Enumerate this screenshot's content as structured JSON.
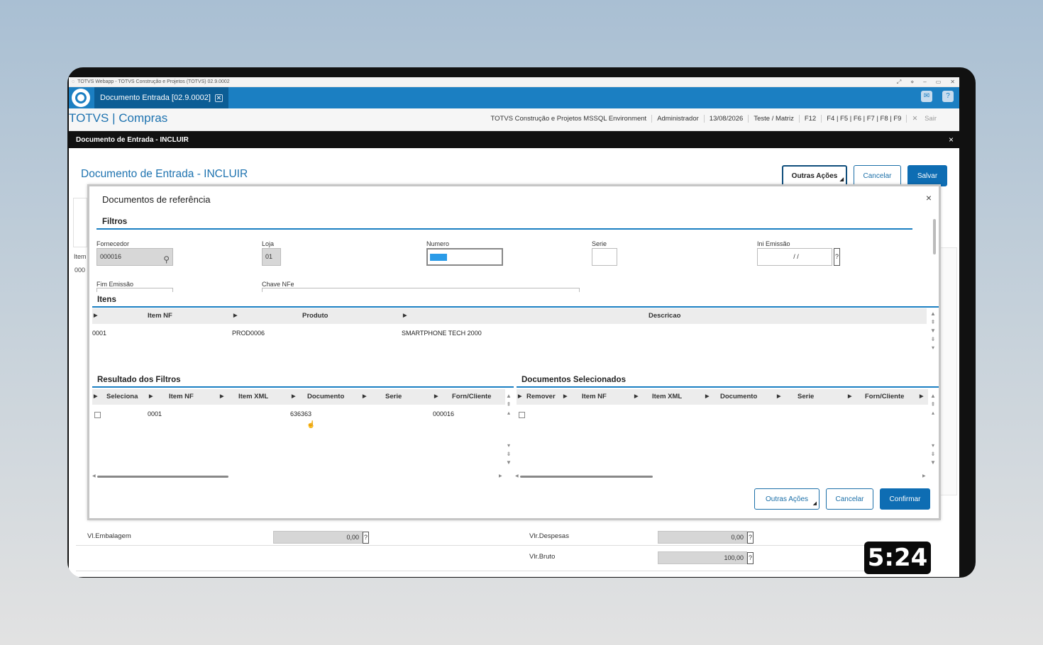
{
  "window": {
    "title": "TOTVS Webapp - TOTVS Construção e Projetos (TOTVS) 02.9.0002",
    "controls": [
      "⤢",
      "⋄",
      "–",
      "▭",
      "✕"
    ]
  },
  "app_tab": {
    "label": "Documento Entrada [02.9.0002]",
    "close": "✕"
  },
  "header_icons": [
    "✉",
    "?"
  ],
  "product": {
    "title": "TOTVS | Compras"
  },
  "status_bar": {
    "environment": "TOTVS Construção e Projetos MSSQL Environment",
    "user": "Administrador",
    "date": "13/08/2026",
    "branch": "Teste / Matriz",
    "f12": "F12",
    "fkeys": "F4 | F5 | F6 | F7 | F8 | F9",
    "exit": "Sair"
  },
  "doc_bar": {
    "title": "Documento de Entrada - INCLUIR",
    "close": "×"
  },
  "page": {
    "title": "Documento de Entrada - INCLUIR",
    "buttons": {
      "other": "Outras Ações",
      "cancel": "Cancelar",
      "save": "Salvar"
    },
    "bg_item_label": "Item",
    "bg_item_value": "000",
    "footer": {
      "embalagem_label": "Vl.Embalagem",
      "embalagem_value": "0,00",
      "despesas_label": "Vlr.Despesas",
      "despesas_value": "0,00",
      "bruto_label": "Vlr.Bruto",
      "bruto_value": "100,00"
    }
  },
  "modal": {
    "title": "Documentos de referência",
    "close": "×",
    "filters": {
      "section": "Filtros",
      "fornecedor_label": "Fornecedor",
      "fornecedor_value": "000016",
      "loja_label": "Loja",
      "loja_value": "01",
      "numero_label": "Numero",
      "numero_value": "",
      "serie_label": "Serie",
      "serie_value": "",
      "ini_emissao_label": "Ini Emissão",
      "ini_emissao_value": "/ /",
      "fim_emissao_label": "Fim Emissão",
      "chave_nfe_label": "Chave NFe"
    },
    "items": {
      "section": "Itens",
      "columns": [
        "Item NF",
        "Produto",
        "Descricao"
      ],
      "rows": [
        {
          "item_nf": "0001",
          "produto": "PROD0006",
          "descricao": "SMARTPHONE TECH 2000"
        }
      ]
    },
    "results": {
      "section": "Resultado dos Filtros",
      "columns": [
        "Seleciona",
        "Item NF",
        "Item XML",
        "Documento",
        "Serie",
        "Forn/Cliente"
      ],
      "rows": [
        {
          "item_nf": "0001",
          "item_xml": "",
          "documento": "636363",
          "serie": "",
          "forn": "000016"
        }
      ]
    },
    "selected": {
      "section": "Documentos Selecionados",
      "columns": [
        "Remover",
        "Item NF",
        "Item XML",
        "Documento",
        "Serie",
        "Forn/Cliente"
      ]
    },
    "buttons": {
      "other": "Outras Ações",
      "cancel": "Cancelar",
      "confirm": "Confirmar"
    }
  },
  "timer": "5:24"
}
